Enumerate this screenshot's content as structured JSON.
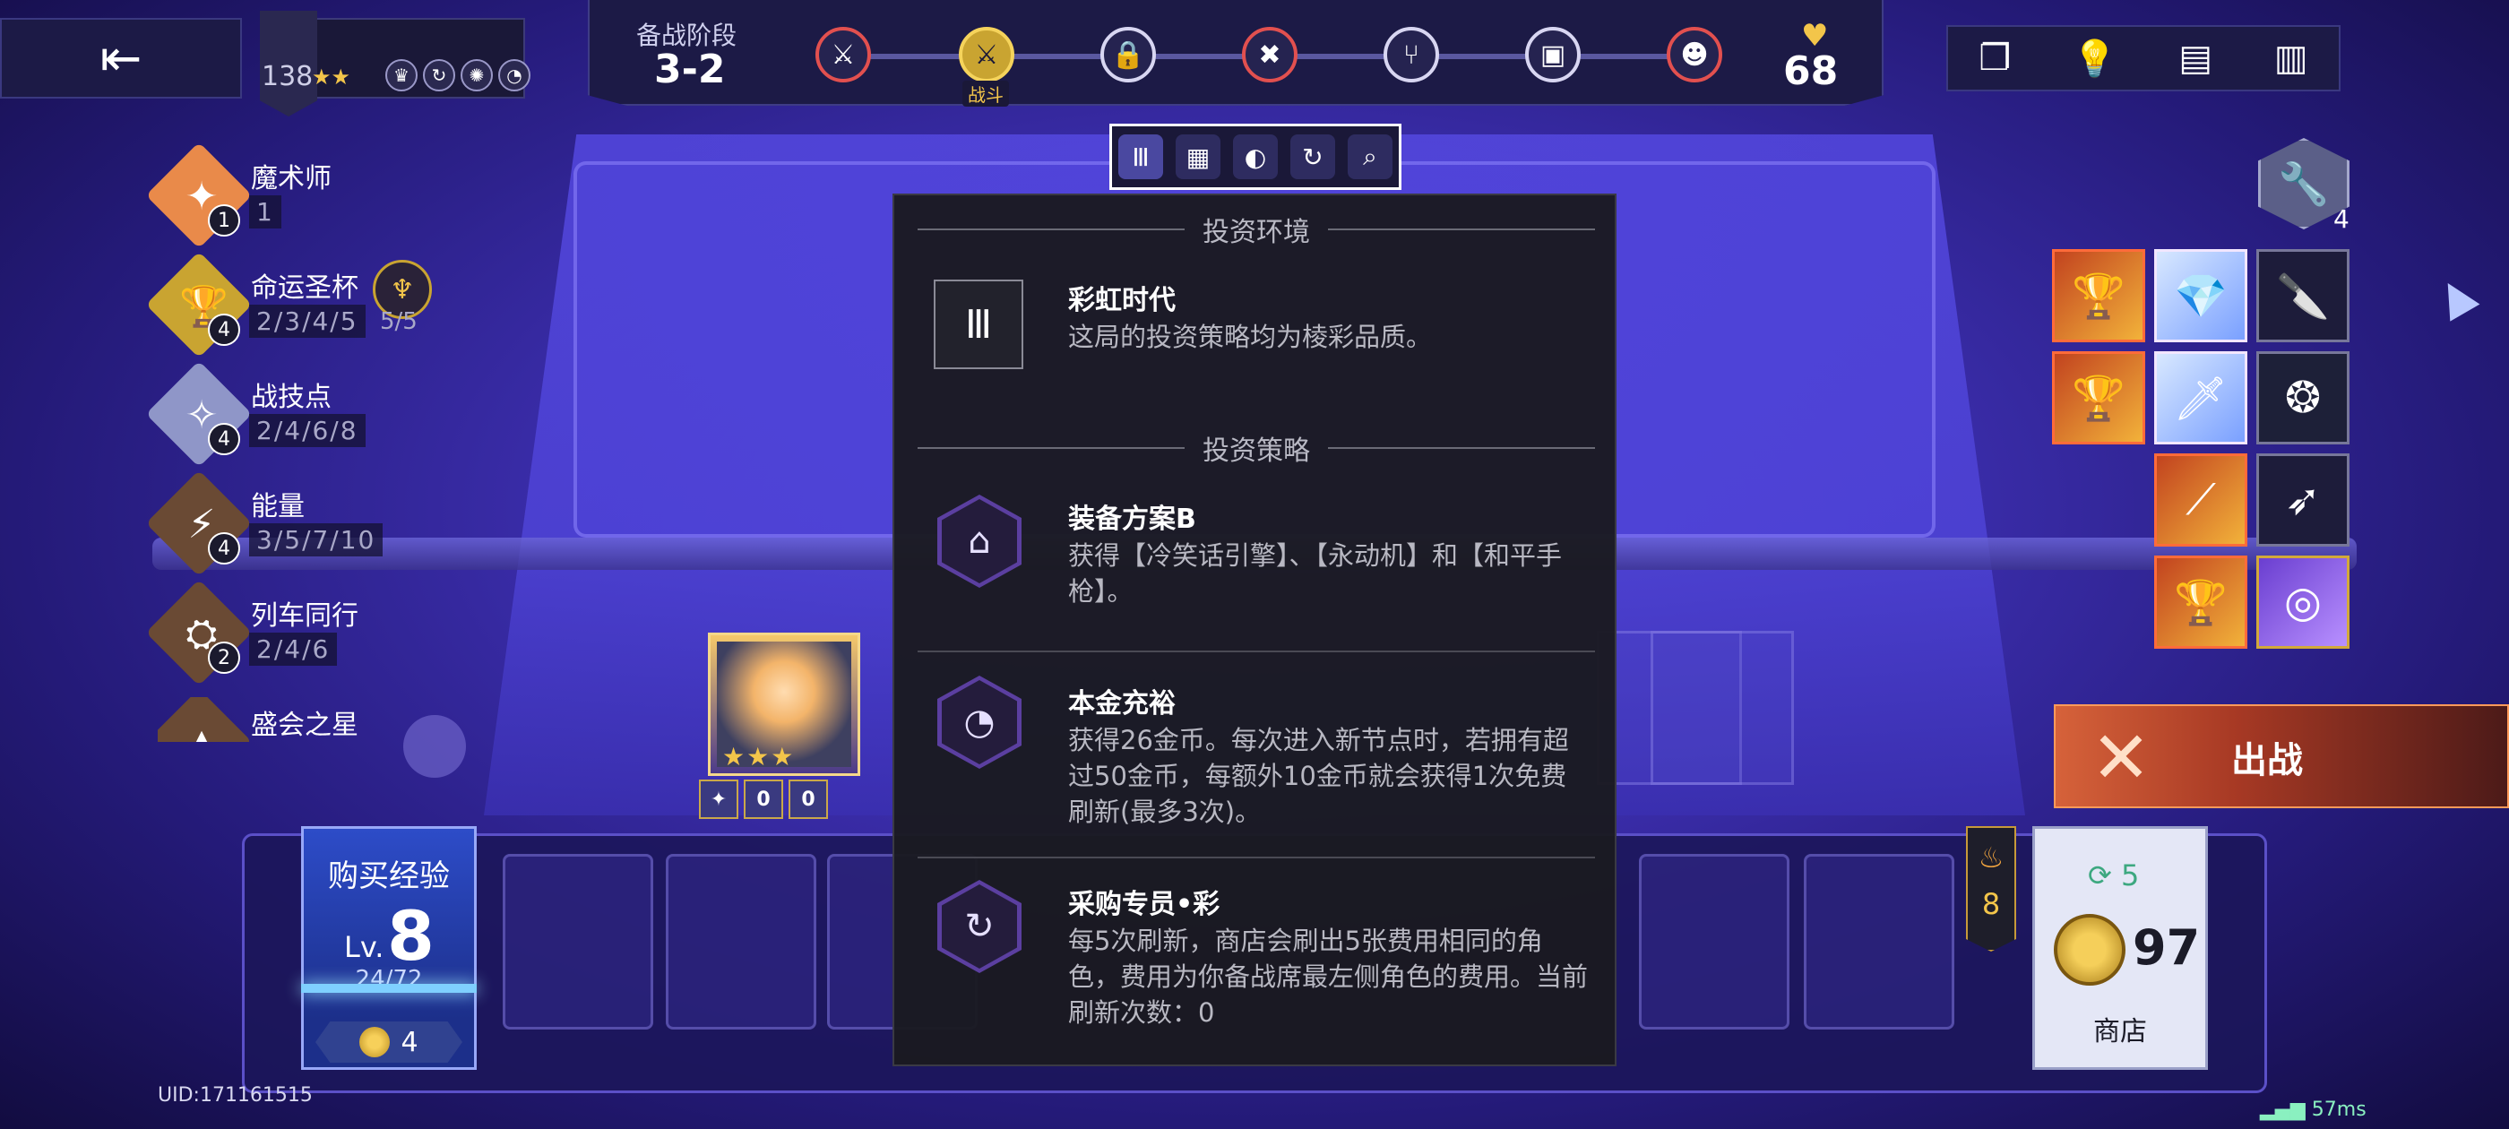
{
  "top_left": {
    "exit_icon": "exit-icon",
    "rank_level": "138",
    "rank_stars": "★★",
    "profile_icons": [
      "crown-icon",
      "cycle-icon",
      "burst-icon",
      "gauge-icon"
    ]
  },
  "phase": {
    "label": "备战阶段",
    "value": "3-2",
    "current_node_label": "战斗",
    "nodes": [
      "sword-icon",
      "sword-icon",
      "lock-icon",
      "crossed-swords-icon",
      "branch-icon",
      "chest-icon",
      "boss-icon"
    ]
  },
  "health": {
    "icon": "heart-icon",
    "value": "68"
  },
  "top_right": [
    "codex-icon",
    "lightbulb-icon",
    "book-icon",
    "stats-icon"
  ],
  "synergies": [
    {
      "name": "魔术师",
      "count": "1",
      "tiers": "1",
      "color": "#e98a4a",
      "icon": "magician-icon"
    },
    {
      "name": "命运圣杯",
      "count": "4",
      "tiers": "2/3/4/5",
      "color": "#c9a431",
      "icon": "grail-icon",
      "extra": "5/5"
    },
    {
      "name": "战技点",
      "count": "4",
      "tiers": "2/4/6/8",
      "color": "#8f96c8",
      "icon": "spark-icon"
    },
    {
      "name": "能量",
      "count": "4",
      "tiers": "3/5/7/10",
      "color": "#6a4a34",
      "icon": "battery-icon"
    },
    {
      "name": "列车同行",
      "count": "2",
      "tiers": "2/4/6",
      "color": "#6a4a34",
      "icon": "train-icon"
    },
    {
      "name": "盛会之星",
      "count": "",
      "tiers": "",
      "color": "#6a4a34",
      "icon": "star-icon"
    }
  ],
  "filter_bar": [
    "strategy-icon",
    "equipment-icon",
    "money-icon",
    "refresh-icon",
    "search-icon"
  ],
  "tooltip": {
    "env_heading": "投资环境",
    "env_title": "彩虹时代",
    "env_desc": "这局的投资策略均为棱彩品质。",
    "strategy_heading": "投资策略",
    "strategies": [
      {
        "title": "装备方案B",
        "desc": "获得【冷笑话引擎】、【永动机】和【和平手枪】。",
        "icon": "equipment-plan-icon"
      },
      {
        "title": "本金充裕",
        "desc": "获得26金币。每次进入新节点时，若拥有超过50金币，每额外10金币就会获得1次免费刷新(最多3次)。",
        "icon": "capital-icon"
      },
      {
        "title": "采购专员•彩",
        "desc": "每5次刷新，商店会刷出5张费用相同的角色，费用为你备战席最左侧角色的费用。当前刷新次数：0",
        "icon": "purchaser-icon"
      }
    ]
  },
  "items": {
    "tool_icon": "wrench-icon",
    "tool_count": "4",
    "list": [
      "grail-icon",
      "crystal-icon",
      "knife-icon",
      "grail-icon",
      "sword-icon",
      "emblem-icon",
      "spear-icon",
      "feather-icon",
      "grail-icon",
      "vortex-icon"
    ]
  },
  "deploy": {
    "label": "出战",
    "icon": "crossed-swords-icon"
  },
  "buy_exp": {
    "title": "购买经验",
    "lv_prefix": "Lv.",
    "level": "8",
    "exp": "24/72",
    "cost": "4"
  },
  "streak": {
    "icon": "flame-icon",
    "value": "8"
  },
  "shop": {
    "refresh_count": "5",
    "gold": "97",
    "label": "商店"
  },
  "hero": {
    "stars": "★★★",
    "item_counts": [
      "0",
      "0"
    ]
  },
  "footer": {
    "uid": "UID:171161515",
    "ping": "57ms"
  }
}
